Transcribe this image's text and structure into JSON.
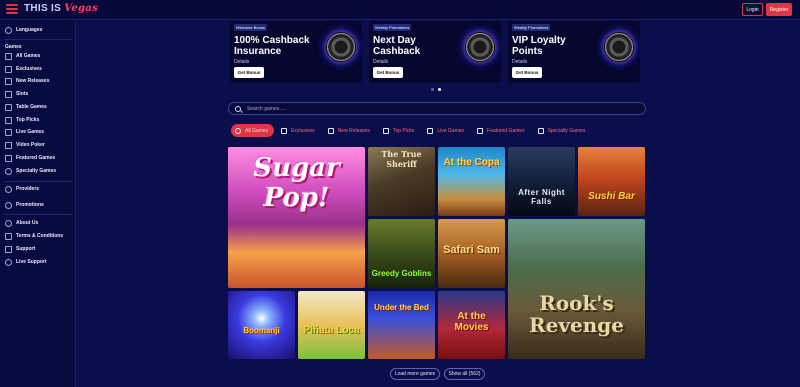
{
  "header": {
    "logo_part1": "THIS IS",
    "logo_part2": "Vegas",
    "login_label": "Login",
    "register_label": "Register"
  },
  "sidebar": {
    "languages": "Languages",
    "games_heading": "Games",
    "game_items": [
      "All Games",
      "Exclusives",
      "New Releases",
      "Slots",
      "Table Games",
      "Top Picks",
      "Live Games",
      "Video Poker",
      "Featured Games",
      "Specialty Games"
    ],
    "providers": "Providers",
    "promotions": "Promotions",
    "info_items": [
      "About Us",
      "Terms & Conditions",
      "Support",
      "Live Support"
    ]
  },
  "promos": [
    {
      "tag": "Welcome Bonus",
      "title": "100% Cashback Insurance",
      "details": "Details",
      "button": "Get Bonus"
    },
    {
      "tag": "Weekly Promotions",
      "title": "Next Day Cashback",
      "details": "Details",
      "button": "Get Bonus"
    },
    {
      "tag": "Weekly Promotions",
      "title": "VIP Loyalty Points",
      "details": "Details",
      "button": "Get Bonus"
    }
  ],
  "search": {
    "placeholder": "Search games....."
  },
  "tabs": [
    "All Games",
    "Exclusives",
    "New Releases",
    "Top Picks",
    "Live Games",
    "Featured Games",
    "Specialty Games"
  ],
  "games": {
    "sugarpop": "Sugar Pop!",
    "sheriff": "The True Sheriff",
    "copa": "At the Copa",
    "afternight": "After Night Falls",
    "sushi": "Sushi Bar",
    "goblins": "Greedy Goblins",
    "safari": "Safari Sam",
    "rooks": "Rook's Revenge",
    "boomanji": "Boomanji",
    "pinata": "Piñata Loca",
    "underbed": "Under the Bed",
    "movies": "At the Movies"
  },
  "footer": {
    "load_more": "Load more games",
    "show_all": "Show all (562)"
  },
  "colors": {
    "accent": "#e03546",
    "background": "#0a0e4a",
    "sidebar": "#070b40"
  }
}
